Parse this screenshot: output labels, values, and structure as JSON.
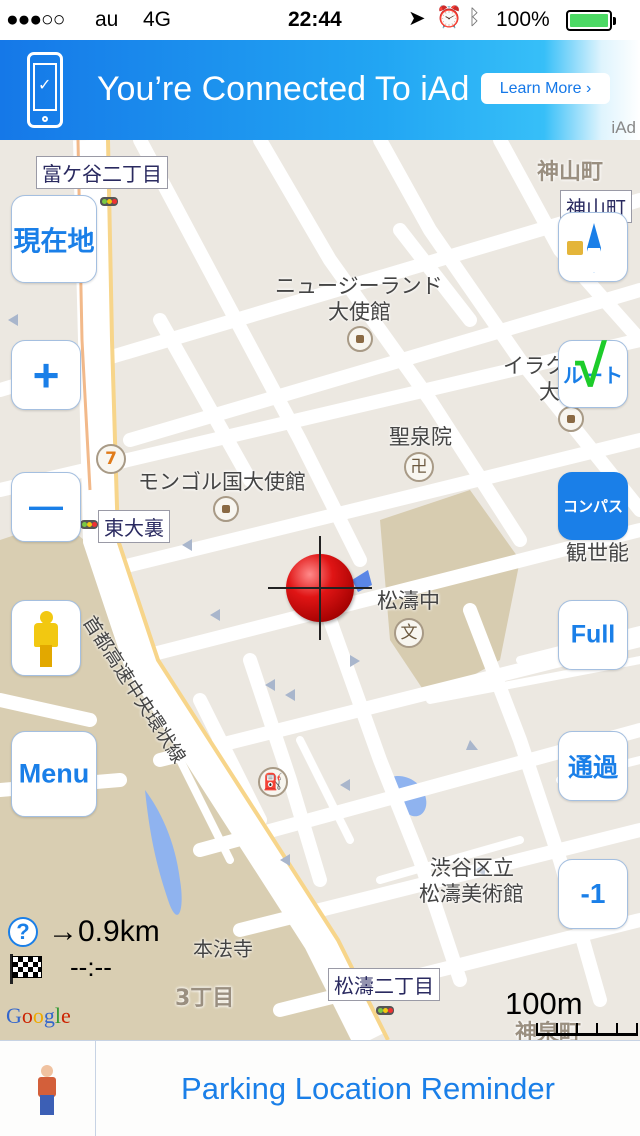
{
  "status_bar": {
    "signal": "●●●○○",
    "carrier": "au",
    "network": "4G",
    "time": "22:44",
    "battery_text": "100%",
    "battery_level": 1.0
  },
  "ad": {
    "title": "You’re Connected To iAd",
    "button": "Learn More ›",
    "brand": "iAd"
  },
  "map": {
    "place_labels": {
      "tomigaya": "富ケ谷二丁目",
      "kamiyama_faint": "神山町",
      "kamiyama_box": "神山町",
      "nz_embassy_1": "ニュージーランド",
      "nz_embassy_2": "大使館",
      "iraq_1": "イラク",
      "iraq_2": "大使",
      "seisenin": "聖泉院",
      "mongol": "モンゴル国大使館",
      "higashi_ooura": "東大裏",
      "kanze": "観世能",
      "shoto_chu": "松濤中",
      "expressway": "首都高速中央環状線",
      "shibuya_museum_1": "渋谷区立",
      "shibuya_museum_2": "松濤美術館",
      "honhoji": "本法寺",
      "shoto2": "松濤二丁目",
      "sanchome": "3丁目",
      "kamiyama_bottom": "神泉町"
    },
    "symbols": {
      "temple": "卍",
      "school": "文",
      "fuel": "⛽",
      "convenience": "7"
    },
    "info": {
      "distance": "→0.9km",
      "time": "--:--",
      "help": "?",
      "attribution": "Google"
    },
    "scale": "100m"
  },
  "buttons": {
    "current_location": "現在地",
    "zoom_in": "+",
    "zoom_out": "—",
    "menu": "Menu",
    "route": "ルート",
    "compass": "コンパス",
    "full": "Full",
    "traffic": "通過",
    "minus_one": "-1"
  },
  "bottom_bar": {
    "title": "Parking Location Reminder"
  },
  "colors": {
    "accent": "#1a7fe8",
    "map_bg": "#ece8e1",
    "park": "#d9ceb2",
    "water": "#8fb3ef",
    "marker": "#d40000"
  }
}
